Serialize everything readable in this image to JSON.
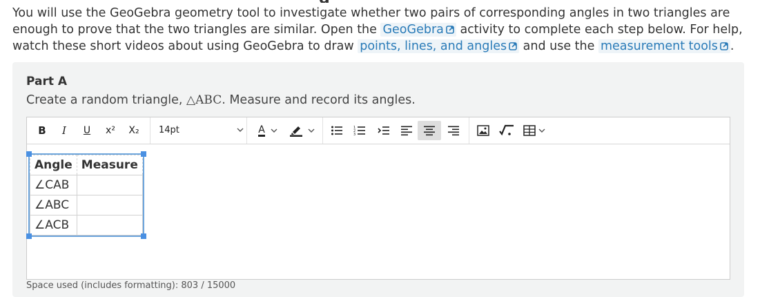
{
  "intro": {
    "text_before": "You will use the GeoGebra geometry tool to investigate whether two pairs of corresponding angles in two triangles are enough to prove that the two triangles are similar. Open the ",
    "link_geogebra": "GeoGebra",
    "text_mid1": " activity to complete each step below. For help, watch these short videos about using GeoGebra to draw ",
    "link_points": "points, lines, and angles",
    "text_mid2": " and use the ",
    "link_tools": "measurement tools",
    "text_end": "."
  },
  "part": {
    "title": "Part A",
    "prompt_before": "Create a random triangle, ",
    "triangle": "△ABC",
    "prompt_after": ". Measure and record its angles."
  },
  "toolbar": {
    "bold": "B",
    "italic": "I",
    "underline": "U",
    "superscript": "x²",
    "subscript": "X₂",
    "font_size": "14pt",
    "font_color_letter": "A",
    "icons": [
      "bullet-list-icon",
      "numbered-list-icon",
      "indent-icon",
      "align-left-icon",
      "align-center-icon",
      "align-right-icon",
      "image-icon",
      "equation-icon",
      "table-icon"
    ]
  },
  "table": {
    "headers": [
      "Angle",
      "Measure"
    ],
    "rows": [
      {
        "angle": "∠CAB",
        "measure": ""
      },
      {
        "angle": "∠ABC",
        "measure": ""
      },
      {
        "angle": "∠ACB",
        "measure": ""
      }
    ]
  },
  "footer": {
    "space_used": "Space used (includes formatting): 803 / 15000"
  },
  "colors": {
    "link": "#2a7bb8",
    "selection": "#4a90e2",
    "card_bg": "#f2f3f3"
  }
}
